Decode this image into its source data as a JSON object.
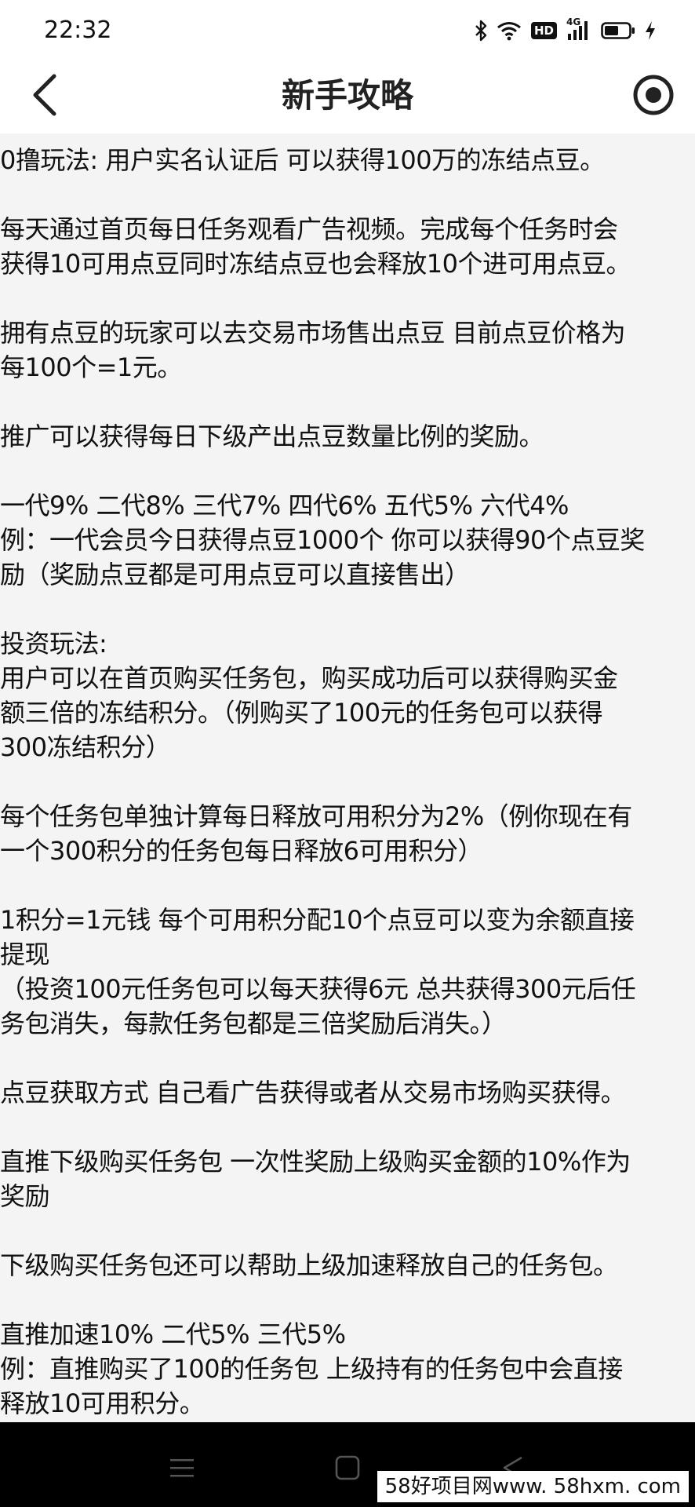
{
  "status_bar": {
    "time": "22:32",
    "icons": [
      "bluetooth-icon",
      "wifi-icon",
      "hd-icon",
      "4g-signal-icon",
      "battery-icon",
      "charging-icon"
    ],
    "hd_label": "HD",
    "network_label": "4G"
  },
  "header": {
    "title": "新手攻略",
    "back_icon": "chevron-left-icon",
    "right_icon": "target-icon"
  },
  "content": {
    "paragraphs": [
      [
        "0撸玩法: 用户实名认证后 可以获得100万的冻结点豆。"
      ],
      [
        "每天通过首页每日任务观看广告视频。完成每个任务时会",
        "获得10可用点豆同时冻结点豆也会释放10个进可用点豆。"
      ],
      [
        "拥有点豆的玩家可以去交易市场售出点豆 目前点豆价格为",
        "每100个=1元。"
      ],
      [
        "推广可以获得每日下级产出点豆数量比例的奖励。"
      ],
      [
        "一代9% 二代8% 三代7% 四代6% 五代5% 六代4%",
        "例：一代会员今日获得点豆1000个 你可以获得90个点豆奖",
        "励（奖励点豆都是可用点豆可以直接售出）"
      ],
      [
        "投资玩法:",
        "用户可以在首页购买任务包，购买成功后可以获得购买金",
        "额三倍的冻结积分。（例购买了100元的任务包可以获得",
        "300冻结积分）"
      ],
      [
        "每个任务包单独计算每日释放可用积分为2%（例你现在有",
        "一个300积分的任务包每日释放6可用积分）"
      ],
      [
        "1积分=1元钱  每个可用积分配10个点豆可以变为余额直接",
        "提现",
        " （投资100元任务包可以每天获得6元 总共获得300元后任",
        "务包消失，每款任务包都是三倍奖励后消失。）"
      ],
      [
        "点豆获取方式 自己看广告获得或者从交易市场购买获得。"
      ],
      [
        "直推下级购买任务包 一次性奖励上级购买金额的10%作为",
        "奖励"
      ],
      [
        "下级购买任务包还可以帮助上级加速释放自己的任务包。"
      ],
      [
        "直推加速10%  二代5%  三代5%",
        "例：直推购买了100的任务包  上级持有的任务包中会直接",
        "释放10可用积分。"
      ]
    ]
  },
  "nav_bar": {
    "buttons": [
      "menu-icon",
      "home-square-icon",
      "back-triangle-icon"
    ]
  },
  "watermark": {
    "text": "58好项目网www. 58hxm. com"
  }
}
